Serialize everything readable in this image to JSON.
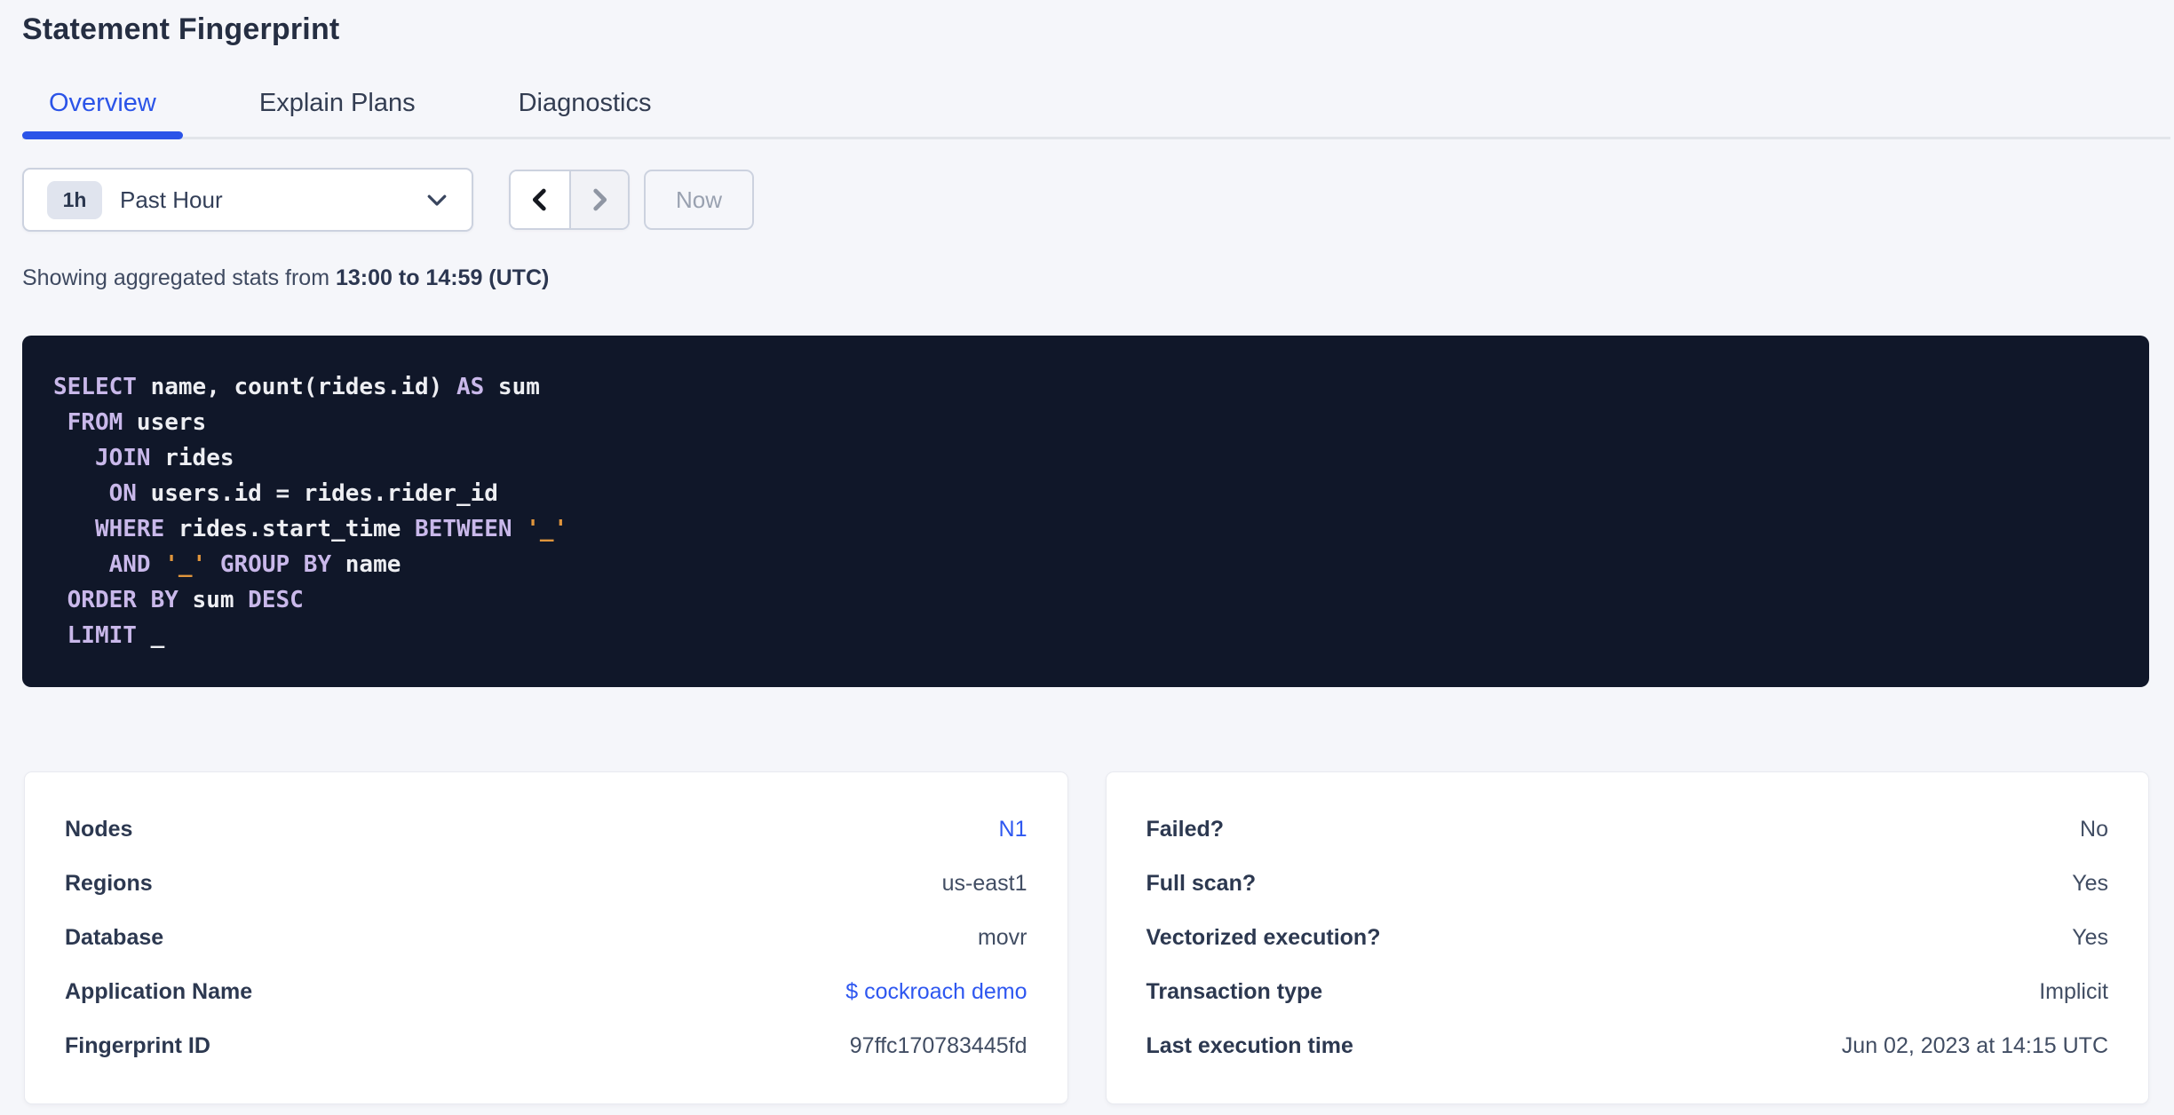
{
  "colors": {
    "page_bg": "#f5f6fa",
    "accent_blue": "#2b54e8",
    "link_blue": "#2e57f0",
    "heading": "#252e42",
    "tab_inactive": "#333d52",
    "divider": "#e2e5ea",
    "control_border": "#ccd2df",
    "muted": "#99a1b0",
    "sql_bg": "#101729",
    "sql_keyword": "#c9b8ea",
    "sql_text": "#edeef2",
    "sql_string": "#e0953c",
    "card_label": "#2c3850",
    "card_value": "#414d63"
  },
  "header": {
    "title": "Statement Fingerprint"
  },
  "tabs": [
    {
      "label": "Overview",
      "active": true
    },
    {
      "label": "Explain Plans",
      "active": false
    },
    {
      "label": "Diagnostics",
      "active": false
    }
  ],
  "time_picker": {
    "interval_badge": "1h",
    "selected": "Past Hour",
    "now_label": "Now"
  },
  "stats_line": {
    "prefix": "Showing aggregated stats from ",
    "range_bold": "13:00 to 14:59 (UTC)"
  },
  "sql": {
    "lines": [
      [
        {
          "t": "kw",
          "v": "SELECT"
        },
        {
          "t": "pl",
          "v": " name, count(rides.id) "
        },
        {
          "t": "kw",
          "v": "AS"
        },
        {
          "t": "pl",
          "v": " sum"
        }
      ],
      [
        {
          "t": "pl",
          "v": " "
        },
        {
          "t": "kw",
          "v": "FROM"
        },
        {
          "t": "pl",
          "v": " users"
        }
      ],
      [
        {
          "t": "pl",
          "v": "   "
        },
        {
          "t": "kw",
          "v": "JOIN"
        },
        {
          "t": "pl",
          "v": " rides"
        }
      ],
      [
        {
          "t": "pl",
          "v": "    "
        },
        {
          "t": "kw",
          "v": "ON"
        },
        {
          "t": "pl",
          "v": " users.id = rides.rider_id"
        }
      ],
      [
        {
          "t": "pl",
          "v": "   "
        },
        {
          "t": "kw",
          "v": "WHERE"
        },
        {
          "t": "pl",
          "v": " rides.start_time "
        },
        {
          "t": "kw",
          "v": "BETWEEN"
        },
        {
          "t": "pl",
          "v": " "
        },
        {
          "t": "str",
          "v": "'_'"
        }
      ],
      [
        {
          "t": "pl",
          "v": "    "
        },
        {
          "t": "kw",
          "v": "AND"
        },
        {
          "t": "pl",
          "v": " "
        },
        {
          "t": "str",
          "v": "'_'"
        },
        {
          "t": "pl",
          "v": " "
        },
        {
          "t": "kw",
          "v": "GROUP BY"
        },
        {
          "t": "pl",
          "v": " name"
        }
      ],
      [
        {
          "t": "pl",
          "v": " "
        },
        {
          "t": "kw",
          "v": "ORDER BY"
        },
        {
          "t": "pl",
          "v": " sum "
        },
        {
          "t": "kw",
          "v": "DESC"
        }
      ],
      [
        {
          "t": "pl",
          "v": " "
        },
        {
          "t": "kw",
          "v": "LIMIT"
        },
        {
          "t": "pl",
          "v": " _"
        }
      ]
    ]
  },
  "cards": {
    "left": {
      "rows": [
        {
          "label": "Nodes",
          "value": "N1",
          "link": true
        },
        {
          "label": "Regions",
          "value": "us-east1",
          "link": false
        },
        {
          "label": "Database",
          "value": "movr",
          "link": false
        },
        {
          "label": "Application Name",
          "value": "$ cockroach demo",
          "link": true
        },
        {
          "label": "Fingerprint ID",
          "value": "97ffc170783445fd",
          "link": false
        }
      ]
    },
    "right": {
      "rows": [
        {
          "label": "Failed?",
          "value": "No",
          "link": false
        },
        {
          "label": "Full scan?",
          "value": "Yes",
          "link": false
        },
        {
          "label": "Vectorized execution?",
          "value": "Yes",
          "link": false
        },
        {
          "label": "Transaction type",
          "value": "Implicit",
          "link": false
        },
        {
          "label": "Last execution time",
          "value": "Jun 02, 2023 at 14:15 UTC",
          "link": false
        }
      ]
    }
  }
}
